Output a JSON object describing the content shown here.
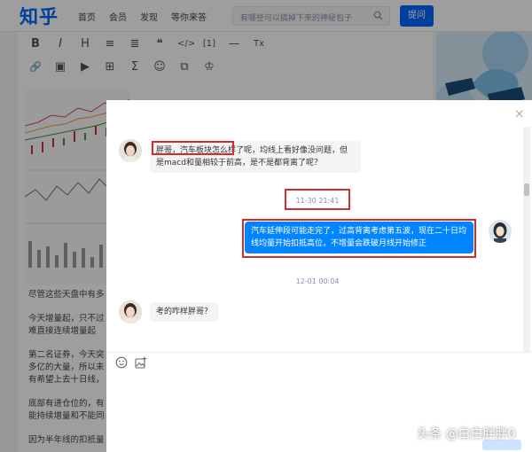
{
  "site": {
    "logo": "知乎",
    "nav": [
      "首页",
      "会员",
      "发现",
      "等你来答"
    ],
    "search_placeholder": "有哪些可以搞掉下来的神秘包子",
    "ask_button": "提问"
  },
  "editor": {
    "toolbar_row1": [
      "B",
      "I",
      "H",
      "≡",
      "≣",
      "❝",
      "</>",
      "[1]",
      "—",
      "Tx"
    ],
    "toolbar_row2": [
      "🔗",
      "▣",
      "▶",
      "⊞",
      "Σ",
      "☺",
      "⧉",
      "♔"
    ],
    "paragraphs": [
      "尽管这些天盘中有多",
      "今天增量起，只不过",
      "难直接连续增量起",
      "第二名证券，今天突",
      "多亿的大量，所以未",
      "有希望上去十日线，",
      "底部有进仓位的，有",
      "能持续增量和不能同",
      "因为半年线的扣抵量"
    ]
  },
  "chat": {
    "close_symbol": "×",
    "messages": [
      {
        "from": "other",
        "text": "胖哥，汽车板块怎么样了呢，均线上看好像没问题，但是macd和量相较于前高，是不是都背离了呢？"
      },
      {
        "time": "11-30 21:41"
      },
      {
        "from": "me",
        "text": "汽车延伸段可能走完了，过高背离考虑第五波，现在二十日均线均量开始扣抵高位，不增量会跌破月线开始修正"
      },
      {
        "time": "12-01 00:04"
      },
      {
        "from": "other",
        "text": "考的咋样胖哥？"
      }
    ],
    "composer_icons": [
      "smile-icon",
      "image-add-icon"
    ]
  },
  "watermark": "头条 @白白胖胖0",
  "colors": {
    "brand": "#0066ff",
    "bubble_out": "#0084ff",
    "highlight": "#d22c2c"
  }
}
